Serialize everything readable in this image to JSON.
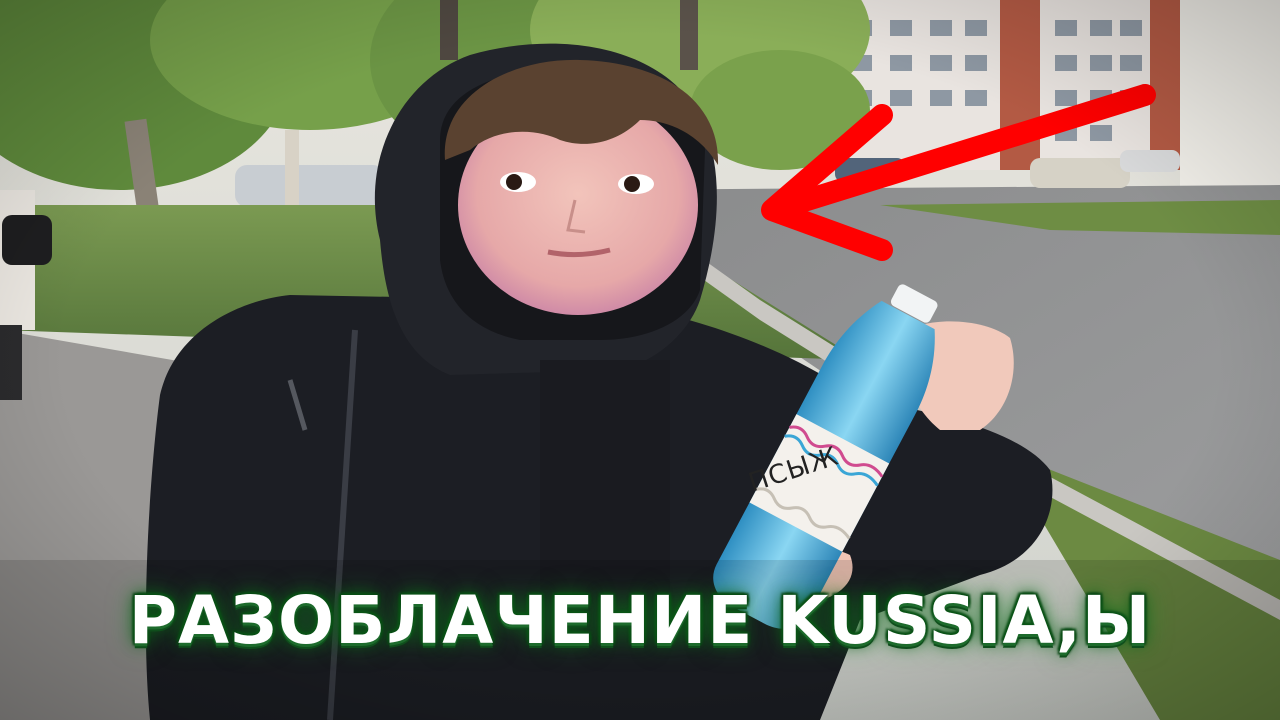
{
  "thumbnail": {
    "title": "РАЗОБЛАЧЕНИЕ KUSSIA,Ы",
    "bottle_label": "ПСЫЖ"
  },
  "colors": {
    "title_glow": "#1d6b2c",
    "arrow": "#ff0000",
    "hoodie": "#1c1e24",
    "water_bottle": "#4fb6e0"
  },
  "icons": [
    "red-arrow"
  ]
}
